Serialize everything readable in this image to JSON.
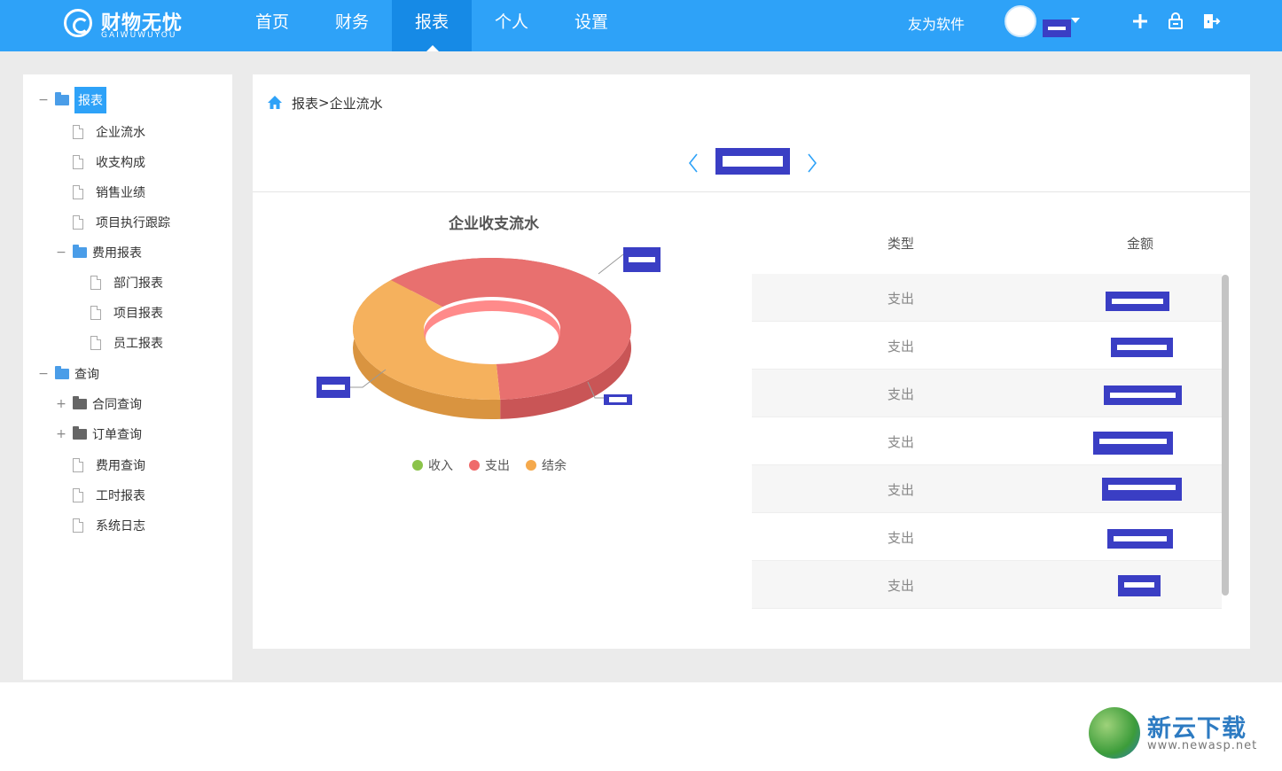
{
  "app": {
    "logo_text": "财物无忧",
    "logo_sub": "GAIWUWUYOU"
  },
  "nav": {
    "items": [
      {
        "label": "首页"
      },
      {
        "label": "财务"
      },
      {
        "label": "报表"
      },
      {
        "label": "个人"
      },
      {
        "label": "设置"
      }
    ],
    "active": "报表"
  },
  "header_right": {
    "brand": "友为软件",
    "icons": [
      "plus-icon",
      "lock-icon",
      "logout-icon"
    ]
  },
  "sidebar": {
    "tree": [
      {
        "label": "报表",
        "kind": "folder",
        "toggle": "−",
        "active": true
      },
      {
        "label": "企业流水",
        "kind": "file"
      },
      {
        "label": "收支构成",
        "kind": "file"
      },
      {
        "label": "销售业绩",
        "kind": "file"
      },
      {
        "label": "项目执行跟踪",
        "kind": "file"
      },
      {
        "label": "费用报表",
        "kind": "folder",
        "toggle": "−"
      },
      {
        "label": "部门报表",
        "kind": "file"
      },
      {
        "label": "项目报表",
        "kind": "file"
      },
      {
        "label": "员工报表",
        "kind": "file"
      },
      {
        "label": "查询",
        "kind": "folder",
        "toggle": "−"
      },
      {
        "label": "合同查询",
        "kind": "folder",
        "toggle": "+"
      },
      {
        "label": "订单查询",
        "kind": "folder",
        "toggle": "+"
      },
      {
        "label": "费用查询",
        "kind": "file"
      },
      {
        "label": "工时报表",
        "kind": "file"
      },
      {
        "label": "系统日志",
        "kind": "file"
      }
    ]
  },
  "breadcrumb": {
    "parent": "报表",
    "separator": ">",
    "current": "企业流水"
  },
  "chart": {
    "title": "企业收支流水",
    "legend": [
      {
        "label": "收入",
        "color": "#8bc34a"
      },
      {
        "label": "支出",
        "color": "#ef6b6b"
      },
      {
        "label": "结余",
        "color": "#f5a94c"
      }
    ]
  },
  "chart_data": {
    "type": "pie",
    "title": "企业收支流水",
    "categories": [
      "收入",
      "支出",
      "结余"
    ],
    "values": [
      0,
      62,
      38
    ]
  },
  "table": {
    "columns": [
      "类型",
      "金额"
    ],
    "rows": [
      {
        "type": "支出"
      },
      {
        "type": "支出"
      },
      {
        "type": "支出"
      },
      {
        "type": "支出"
      },
      {
        "type": "支出"
      },
      {
        "type": "支出"
      },
      {
        "type": "支出"
      }
    ]
  },
  "watermark": {
    "title": "新云下载",
    "url": "www.newasp.net"
  },
  "colors": {
    "primary": "#2ea2f8",
    "nav_active": "#168ae6",
    "redaction": "#3a3ec4",
    "expense": "#e8706f",
    "balance": "#f5b15d"
  }
}
